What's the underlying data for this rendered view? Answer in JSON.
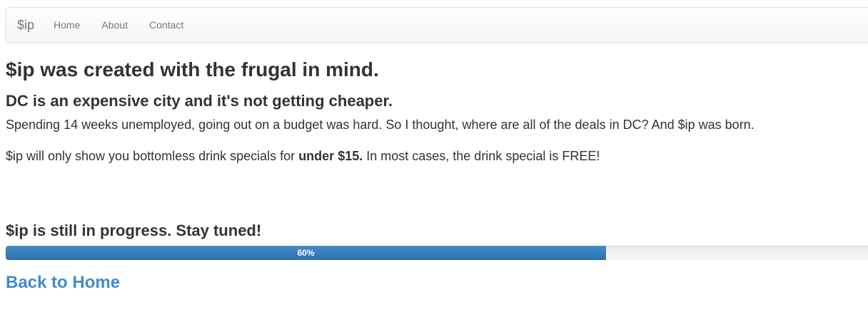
{
  "navbar": {
    "brand": "$ip",
    "links": [
      "Home",
      "About",
      "Contact"
    ]
  },
  "main": {
    "title": "$ip was created with the frugal in mind.",
    "subtitle": "DC is an expensive city and it's not getting cheaper.",
    "paragraph1": "Spending 14 weeks unemployed, going out on a budget was hard. So I thought, where are all of the deals in DC? And $ip was born.",
    "paragraph2_before": "$ip will only show you bottomless drink specials for ",
    "paragraph2_bold": "under $15.",
    "paragraph2_after": " In most cases, the drink special is FREE!"
  },
  "progress": {
    "title": "$ip is still in progress. Stay tuned!",
    "label": "60%",
    "value": 0.6
  },
  "back_link": "Back to Home",
  "colors": {
    "accent": "#428bca",
    "text": "#333333",
    "nav_text": "#777777"
  }
}
